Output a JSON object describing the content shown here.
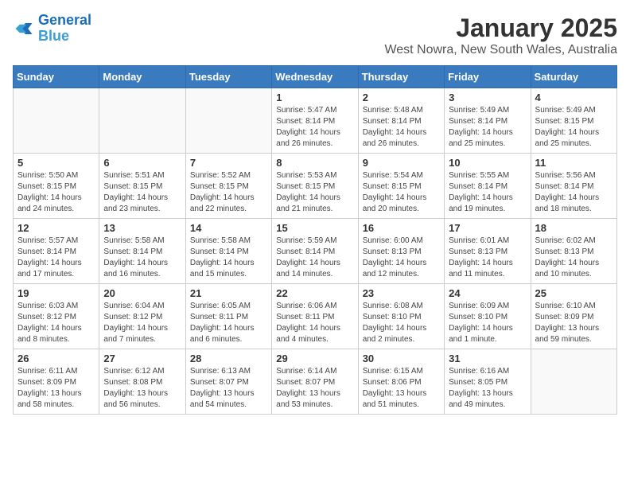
{
  "logo": {
    "line1": "General",
    "line2": "Blue"
  },
  "title": "January 2025",
  "subtitle": "West Nowra, New South Wales, Australia",
  "weekdays": [
    "Sunday",
    "Monday",
    "Tuesday",
    "Wednesday",
    "Thursday",
    "Friday",
    "Saturday"
  ],
  "weeks": [
    [
      {
        "day": "",
        "info": ""
      },
      {
        "day": "",
        "info": ""
      },
      {
        "day": "",
        "info": ""
      },
      {
        "day": "1",
        "info": "Sunrise: 5:47 AM\nSunset: 8:14 PM\nDaylight: 14 hours\nand 26 minutes."
      },
      {
        "day": "2",
        "info": "Sunrise: 5:48 AM\nSunset: 8:14 PM\nDaylight: 14 hours\nand 26 minutes."
      },
      {
        "day": "3",
        "info": "Sunrise: 5:49 AM\nSunset: 8:14 PM\nDaylight: 14 hours\nand 25 minutes."
      },
      {
        "day": "4",
        "info": "Sunrise: 5:49 AM\nSunset: 8:15 PM\nDaylight: 14 hours\nand 25 minutes."
      }
    ],
    [
      {
        "day": "5",
        "info": "Sunrise: 5:50 AM\nSunset: 8:15 PM\nDaylight: 14 hours\nand 24 minutes."
      },
      {
        "day": "6",
        "info": "Sunrise: 5:51 AM\nSunset: 8:15 PM\nDaylight: 14 hours\nand 23 minutes."
      },
      {
        "day": "7",
        "info": "Sunrise: 5:52 AM\nSunset: 8:15 PM\nDaylight: 14 hours\nand 22 minutes."
      },
      {
        "day": "8",
        "info": "Sunrise: 5:53 AM\nSunset: 8:15 PM\nDaylight: 14 hours\nand 21 minutes."
      },
      {
        "day": "9",
        "info": "Sunrise: 5:54 AM\nSunset: 8:15 PM\nDaylight: 14 hours\nand 20 minutes."
      },
      {
        "day": "10",
        "info": "Sunrise: 5:55 AM\nSunset: 8:14 PM\nDaylight: 14 hours\nand 19 minutes."
      },
      {
        "day": "11",
        "info": "Sunrise: 5:56 AM\nSunset: 8:14 PM\nDaylight: 14 hours\nand 18 minutes."
      }
    ],
    [
      {
        "day": "12",
        "info": "Sunrise: 5:57 AM\nSunset: 8:14 PM\nDaylight: 14 hours\nand 17 minutes."
      },
      {
        "day": "13",
        "info": "Sunrise: 5:58 AM\nSunset: 8:14 PM\nDaylight: 14 hours\nand 16 minutes."
      },
      {
        "day": "14",
        "info": "Sunrise: 5:58 AM\nSunset: 8:14 PM\nDaylight: 14 hours\nand 15 minutes."
      },
      {
        "day": "15",
        "info": "Sunrise: 5:59 AM\nSunset: 8:14 PM\nDaylight: 14 hours\nand 14 minutes."
      },
      {
        "day": "16",
        "info": "Sunrise: 6:00 AM\nSunset: 8:13 PM\nDaylight: 14 hours\nand 12 minutes."
      },
      {
        "day": "17",
        "info": "Sunrise: 6:01 AM\nSunset: 8:13 PM\nDaylight: 14 hours\nand 11 minutes."
      },
      {
        "day": "18",
        "info": "Sunrise: 6:02 AM\nSunset: 8:13 PM\nDaylight: 14 hours\nand 10 minutes."
      }
    ],
    [
      {
        "day": "19",
        "info": "Sunrise: 6:03 AM\nSunset: 8:12 PM\nDaylight: 14 hours\nand 8 minutes."
      },
      {
        "day": "20",
        "info": "Sunrise: 6:04 AM\nSunset: 8:12 PM\nDaylight: 14 hours\nand 7 minutes."
      },
      {
        "day": "21",
        "info": "Sunrise: 6:05 AM\nSunset: 8:11 PM\nDaylight: 14 hours\nand 6 minutes."
      },
      {
        "day": "22",
        "info": "Sunrise: 6:06 AM\nSunset: 8:11 PM\nDaylight: 14 hours\nand 4 minutes."
      },
      {
        "day": "23",
        "info": "Sunrise: 6:08 AM\nSunset: 8:10 PM\nDaylight: 14 hours\nand 2 minutes."
      },
      {
        "day": "24",
        "info": "Sunrise: 6:09 AM\nSunset: 8:10 PM\nDaylight: 14 hours\nand 1 minute."
      },
      {
        "day": "25",
        "info": "Sunrise: 6:10 AM\nSunset: 8:09 PM\nDaylight: 13 hours\nand 59 minutes."
      }
    ],
    [
      {
        "day": "26",
        "info": "Sunrise: 6:11 AM\nSunset: 8:09 PM\nDaylight: 13 hours\nand 58 minutes."
      },
      {
        "day": "27",
        "info": "Sunrise: 6:12 AM\nSunset: 8:08 PM\nDaylight: 13 hours\nand 56 minutes."
      },
      {
        "day": "28",
        "info": "Sunrise: 6:13 AM\nSunset: 8:07 PM\nDaylight: 13 hours\nand 54 minutes."
      },
      {
        "day": "29",
        "info": "Sunrise: 6:14 AM\nSunset: 8:07 PM\nDaylight: 13 hours\nand 53 minutes."
      },
      {
        "day": "30",
        "info": "Sunrise: 6:15 AM\nSunset: 8:06 PM\nDaylight: 13 hours\nand 51 minutes."
      },
      {
        "day": "31",
        "info": "Sunrise: 6:16 AM\nSunset: 8:05 PM\nDaylight: 13 hours\nand 49 minutes."
      },
      {
        "day": "",
        "info": ""
      }
    ]
  ]
}
